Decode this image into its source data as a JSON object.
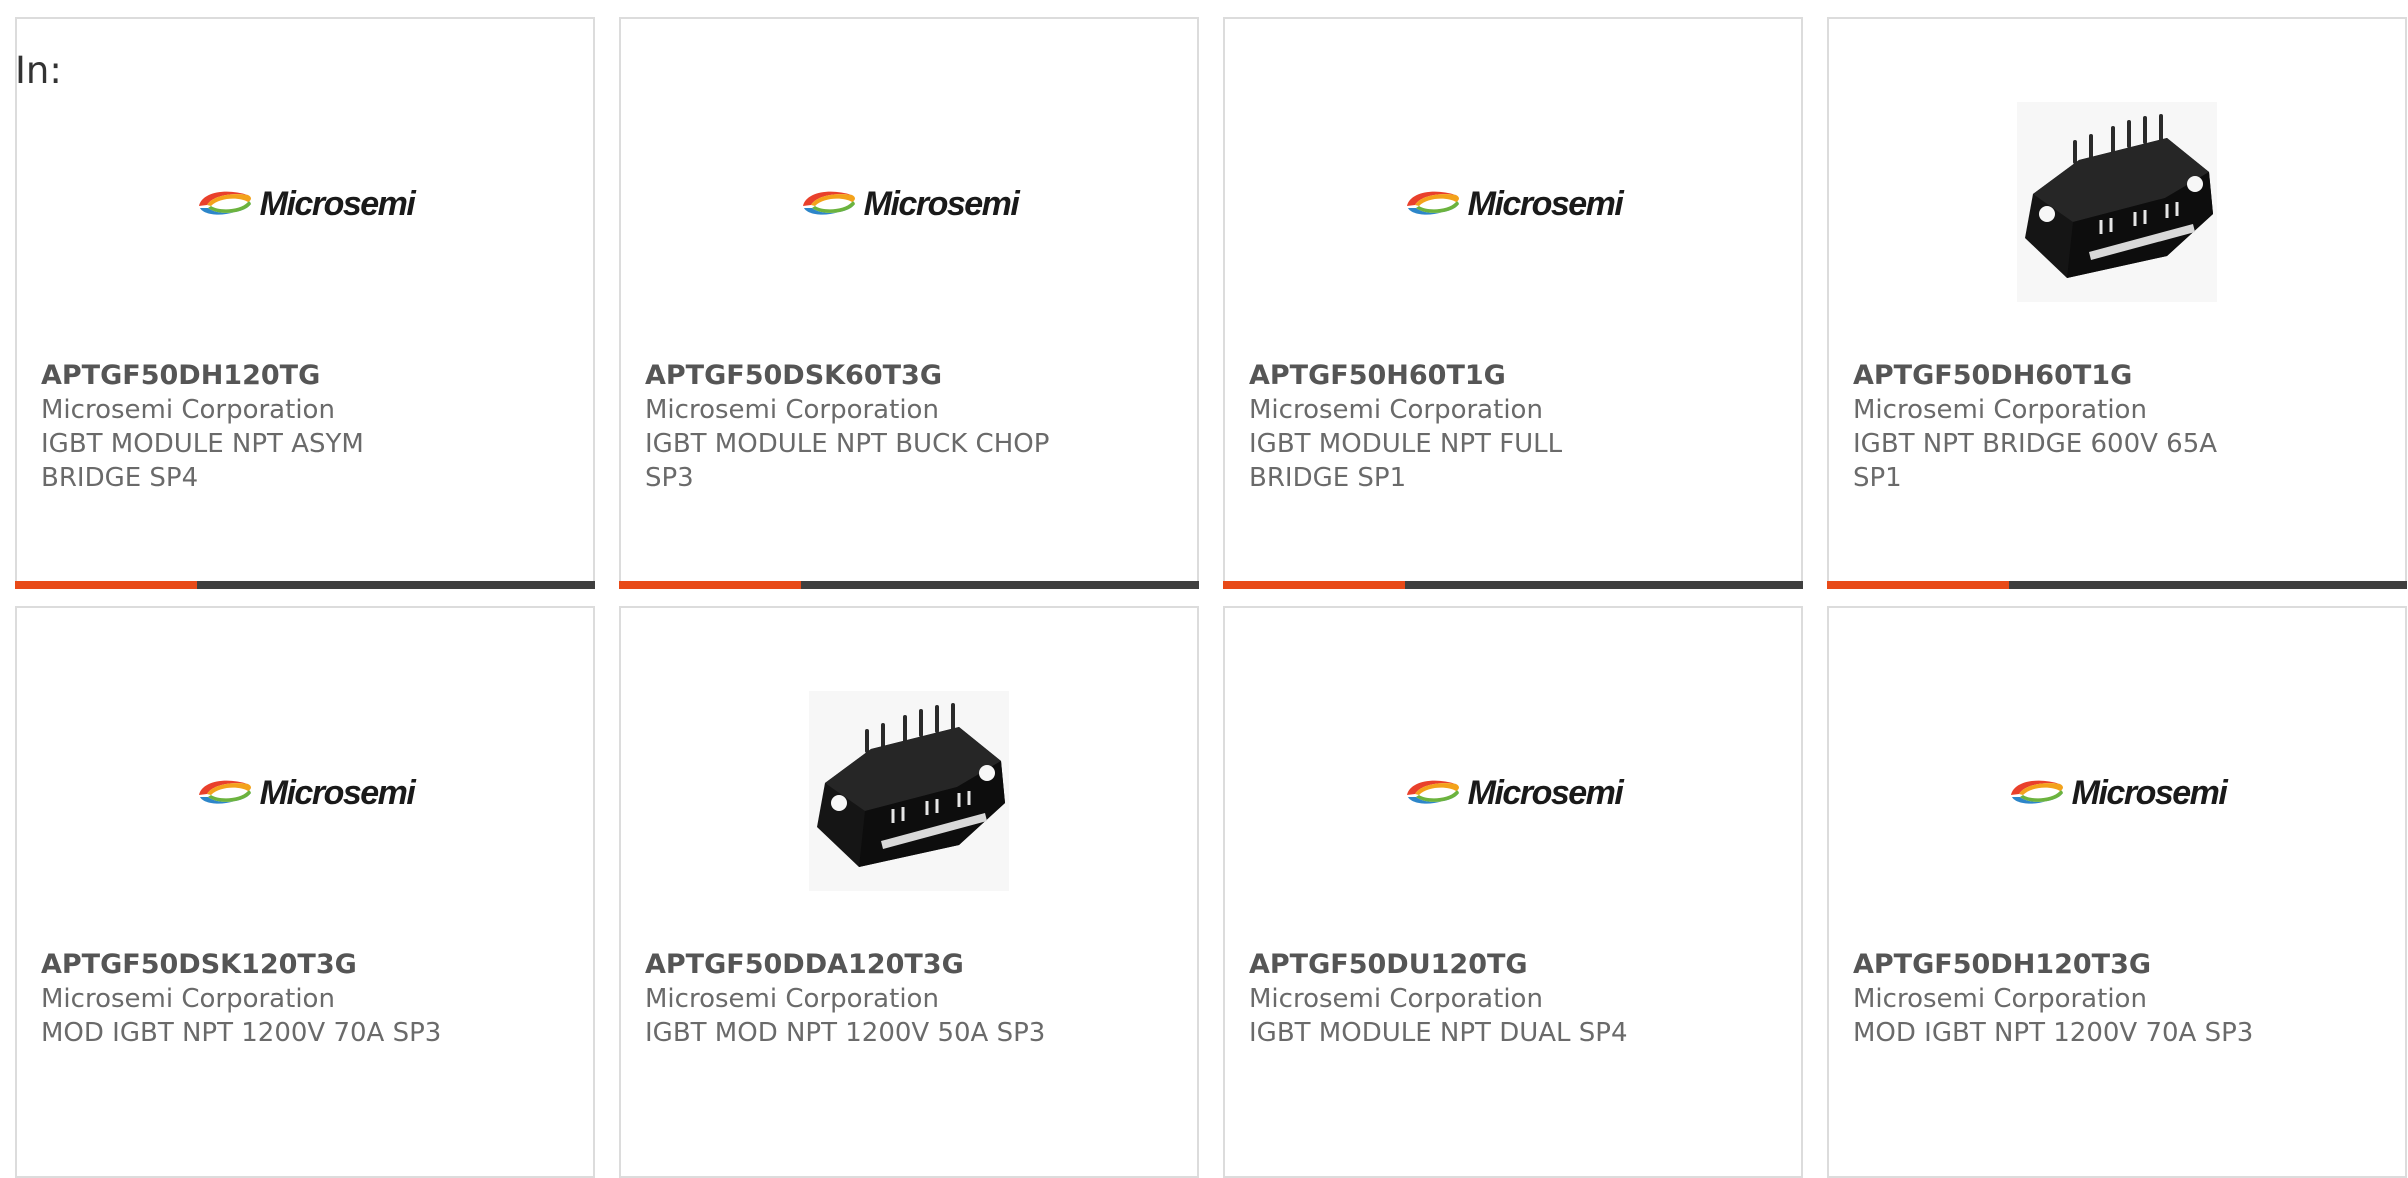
{
  "page": {
    "heading": "In:"
  },
  "products": [
    {
      "part_number": "APTGF50DH120TG",
      "manufacturer": "Microsemi Corporation",
      "description": "IGBT MODULE NPT ASYM BRIDGE SP4",
      "image": "microsemi-logo",
      "logo_text": "Microsemi",
      "accent": true
    },
    {
      "part_number": "APTGF50DSK60T3G",
      "manufacturer": "Microsemi Corporation",
      "description": "IGBT MODULE NPT BUCK CHOP SP3",
      "image": "microsemi-logo",
      "logo_text": "Microsemi",
      "accent": true
    },
    {
      "part_number": "APTGF50H60T1G",
      "manufacturer": "Microsemi Corporation",
      "description": "IGBT MODULE NPT FULL BRIDGE SP1",
      "image": "microsemi-logo",
      "logo_text": "Microsemi",
      "accent": true
    },
    {
      "part_number": "APTGF50DH60T1G",
      "manufacturer": "Microsemi Corporation",
      "description": "IGBT NPT BRIDGE 600V 65A SP1",
      "image": "module-photo",
      "logo_text": "",
      "accent": true
    },
    {
      "part_number": "APTGF50DSK120T3G",
      "manufacturer": "Microsemi Corporation",
      "description": "MOD IGBT NPT 1200V 70A SP3",
      "image": "microsemi-logo",
      "logo_text": "Microsemi",
      "accent": false
    },
    {
      "part_number": "APTGF50DDA120T3G",
      "manufacturer": "Microsemi Corporation",
      "description": "IGBT MOD NPT 1200V 50A SP3",
      "image": "module-photo",
      "logo_text": "",
      "accent": false
    },
    {
      "part_number": "APTGF50DU120TG",
      "manufacturer": "Microsemi Corporation",
      "description": "IGBT MODULE NPT DUAL SP4",
      "image": "microsemi-logo",
      "logo_text": "Microsemi",
      "accent": false
    },
    {
      "part_number": "APTGF50DH120T3G",
      "manufacturer": "Microsemi Corporation",
      "description": "MOD IGBT NPT 1200V 70A SP3",
      "image": "microsemi-logo",
      "logo_text": "Microsemi",
      "accent": false
    }
  ],
  "colors": {
    "accent_orange": "#e84a18",
    "accent_dark": "#3f3f3f",
    "card_border": "#dcdcdc",
    "text_gray": "#6a6a6a"
  }
}
